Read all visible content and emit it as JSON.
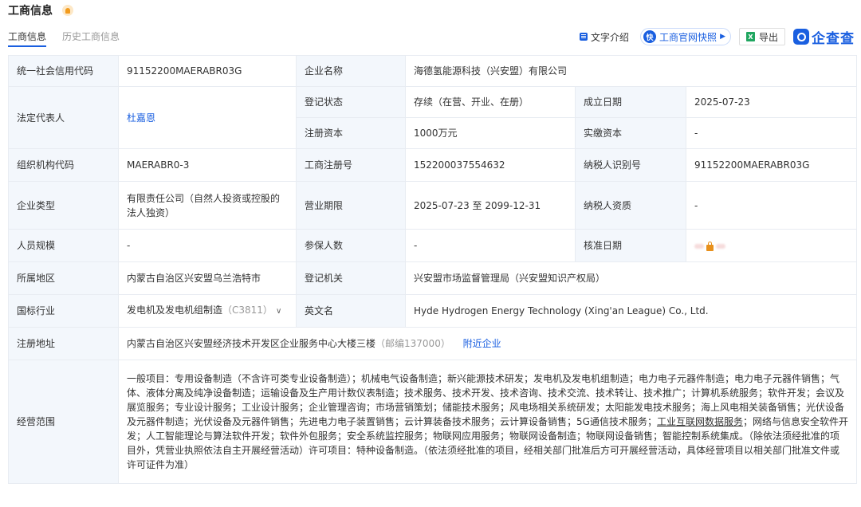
{
  "page": {
    "title": "工商信息"
  },
  "tabs": [
    {
      "label": "工商信息",
      "active": true
    },
    {
      "label": "历史工商信息",
      "active": false
    }
  ],
  "toolbar": {
    "text_intro": "文字介绍",
    "snapshot": "工商官网快照",
    "export": "导出",
    "logo": "企查查"
  },
  "icons": {
    "bell": "bell-icon",
    "doc": "document-icon",
    "snapshot": "snapshot-icon",
    "excel": "excel-icon",
    "lock": "lock-icon"
  },
  "colors": {
    "accent": "#1a5fe0",
    "label_bg": "#f3f7fc",
    "border": "#e8ecf2",
    "warning": "#f29b1d"
  },
  "fields": {
    "credit_code": {
      "label": "统一社会信用代码",
      "value": "91152200MAERABR03G"
    },
    "company_name": {
      "label": "企业名称",
      "value": "海德氢能源科技（兴安盟）有限公司"
    },
    "legal_rep": {
      "label": "法定代表人",
      "value": "杜嘉恩"
    },
    "reg_status": {
      "label": "登记状态",
      "value": "存续（在营、开业、在册）"
    },
    "established": {
      "label": "成立日期",
      "value": "2025-07-23"
    },
    "reg_capital": {
      "label": "注册资本",
      "value": "1000万元"
    },
    "paid_capital": {
      "label": "实缴资本",
      "value": "-"
    },
    "org_code": {
      "label": "组织机构代码",
      "value": "MAERABR0-3"
    },
    "biz_reg_no": {
      "label": "工商注册号",
      "value": "152200037554632"
    },
    "taxpayer_id": {
      "label": "纳税人识别号",
      "value": "91152200MAERABR03G"
    },
    "company_type": {
      "label": "企业类型",
      "value": "有限责任公司（自然人投资或控股的法人独资）"
    },
    "biz_term": {
      "label": "营业期限",
      "value": "2025-07-23 至 2099-12-31"
    },
    "taxpayer_qual": {
      "label": "纳税人资质",
      "value": "-"
    },
    "staff_size": {
      "label": "人员规模",
      "value": "-"
    },
    "insured": {
      "label": "参保人数",
      "value": "-"
    },
    "approval_date": {
      "label": "核准日期"
    },
    "region": {
      "label": "所属地区",
      "value": "内蒙古自治区兴安盟乌兰浩特市"
    },
    "reg_authority": {
      "label": "登记机关",
      "value": "兴安盟市场监督管理局（兴安盟知识产权局）"
    },
    "industry": {
      "label": "国标行业",
      "value": "发电机及发电机组制造",
      "code": "（C3811）",
      "chevron": "∨"
    },
    "english_name": {
      "label": "英文名",
      "value": "Hyde Hydrogen Energy Technology (Xing'an League) Co., Ltd."
    },
    "address": {
      "label": "注册地址",
      "value": "内蒙古自治区兴安盟经济技术开发区企业服务中心大楼三楼",
      "postcode": "（邮编137000）",
      "nearby": "附近企业"
    },
    "scope": {
      "label": "经营范围",
      "part1": "一般项目：专用设备制造（不含许可类专业设备制造）；机械电气设备制造；新兴能源技术研发；发电机及发电机组制造；电力电子元器件制造；电力电子元器件销售；气体、液体分离及纯净设备制造；运输设备及生产用计数仪表制造；技术服务、技术开发、技术咨询、技术交流、技术转让、技术推广；计算机系统服务；软件开发；会议及展览服务；专业设计服务；工业设计服务；企业管理咨询；市场营销策划；储能技术服务；风电场相关系统研发；太阳能发电技术服务；海上风电相关装备销售；光伏设备及元器件制造；光伏设备及元器件销售；先进电力电子装置销售；云计算装备技术服务；云计算设备销售；5G通信技术服务；",
      "underlined": "工业互联网数据服务",
      "part2": "；网络与信息安全软件开发；人工智能理论与算法软件开发；软件外包服务；安全系统监控服务；物联网应用服务；物联网设备制造；物联网设备销售；智能控制系统集成。（除依法须经批准的项目外，凭营业执照依法自主开展经营活动）许可项目：特种设备制造。（依法须经批准的项目，经相关部门批准后方可开展经营活动，具体经营项目以相关部门批准文件或许可证件为准）"
    }
  }
}
